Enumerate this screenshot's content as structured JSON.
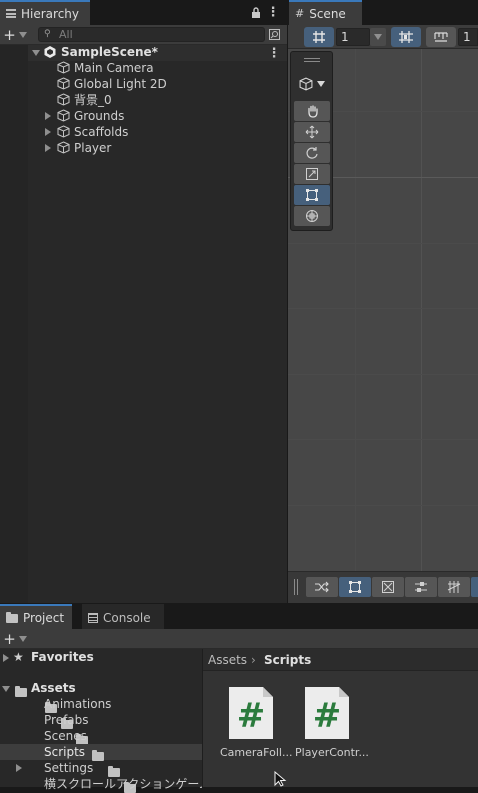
{
  "hierarchy": {
    "tab_label": "Hierarchy",
    "search_placeholder": "All",
    "scene_name": "SampleScene*",
    "items": [
      {
        "label": "Main Camera",
        "expandable": false
      },
      {
        "label": "Global Light 2D",
        "expandable": false
      },
      {
        "label": "背景_0",
        "expandable": false
      },
      {
        "label": "Grounds",
        "expandable": true
      },
      {
        "label": "Scaffolds",
        "expandable": true
      },
      {
        "label": "Player",
        "expandable": true
      }
    ]
  },
  "scene": {
    "tab_label": "Scene",
    "grid_value": "1",
    "snap_value": "1",
    "tools": [
      "hand",
      "move",
      "rotate",
      "scale",
      "rect",
      "transform"
    ],
    "active_tool": "rect"
  },
  "project": {
    "tab_label": "Project",
    "console_tab_label": "Console",
    "favorites_label": "Favorites",
    "assets_label": "Assets",
    "folders": [
      {
        "label": "Animations",
        "expandable": false
      },
      {
        "label": "Prefabs",
        "expandable": false
      },
      {
        "label": "Scenes",
        "expandable": false
      },
      {
        "label": "Scripts",
        "expandable": false,
        "selected": true
      },
      {
        "label": "Settings",
        "expandable": true
      },
      {
        "label": "横スクロールアクションゲーム画像素",
        "expandable": false
      }
    ],
    "breadcrumb": {
      "root": "Assets",
      "current": "Scripts"
    },
    "files": [
      {
        "label": "CameraFoll..."
      },
      {
        "label": "PlayerContr..."
      }
    ]
  },
  "colors": {
    "accent": "#3a79bb",
    "panel": "#282828",
    "selected_row": "#3d3d3d",
    "scene_bg": "#474747",
    "tool_active": "#46607c",
    "script_hash": "#2b7b3d"
  }
}
